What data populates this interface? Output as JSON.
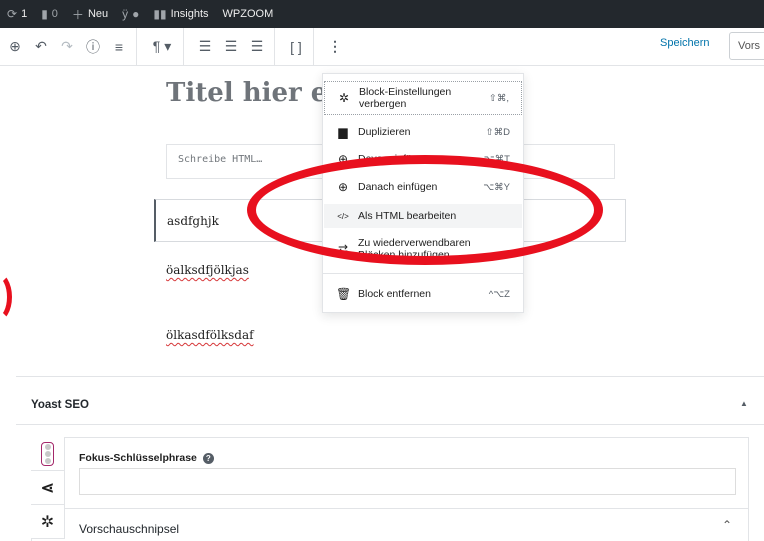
{
  "adminbar": {
    "updates_count": "1",
    "comments_count": "0",
    "new_label": "Neu",
    "insights_label": "Insights",
    "wpzoom_label": "WPZOOM"
  },
  "toolbar": {
    "save_label": "Speichern",
    "preview_label": "Vors"
  },
  "editor": {
    "title_placeholder": "Titel hier e",
    "html_placeholder": "Schreibe HTML…",
    "selected_block_text": "asdfghjk",
    "paragraphs": [
      "öalksdfjölkjas",
      "ölkasdfölksdaf"
    ]
  },
  "menu": {
    "items": [
      {
        "label": "Block-Einstellungen verbergen",
        "shortcut": "⇧⌘,",
        "icon": "gear-icon"
      },
      {
        "label": "Duplizieren",
        "shortcut": "⇧⌘D",
        "icon": "duplicate-icon"
      },
      {
        "label": "Davor einfügen",
        "shortcut": "⌥⌘T",
        "icon": "insert-before-icon"
      },
      {
        "label": "Danach einfügen",
        "shortcut": "⌥⌘Y",
        "icon": "insert-after-icon"
      },
      {
        "label": "Als HTML bearbeiten",
        "shortcut": "",
        "icon": "html-icon"
      },
      {
        "label": "Zu wiederverwendbaren Blöcken hinzufügen",
        "shortcut": "",
        "icon": "reusable-icon"
      },
      {
        "label": "Block entfernen",
        "shortcut": "^⌥Z",
        "icon": "trash-icon"
      }
    ]
  },
  "yoast": {
    "title": "Yoast SEO",
    "focus_keyphrase_label": "Fokus-Schlüsselphrase",
    "focus_keyphrase_value": "",
    "snippet_label": "Vorschauschnipsel"
  },
  "colors": {
    "adminbar_bg": "#23282d",
    "link_blue": "#0073aa",
    "annotation_red": "#e8101e",
    "yoast_purple": "#a4286a"
  }
}
